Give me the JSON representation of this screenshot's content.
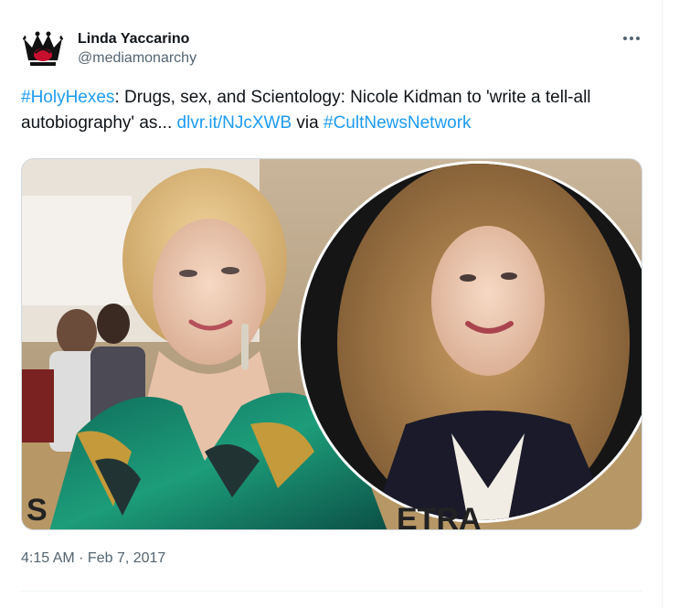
{
  "author": {
    "display_name": "Linda Yaccarino",
    "handle": "@mediamonarchy"
  },
  "tweet": {
    "hashtag1": "#HolyHexes",
    "text1": ": Drugs, sex, and Scientology: Nicole Kidman to 'write a tell-all autobiography' as... ",
    "link": "dlvr.it/NJcXWB",
    "text2": " via ",
    "hashtag2": "#CultNewsNetwork"
  },
  "media": {
    "sign_text": "ETRA",
    "sign_text_left": "S"
  },
  "meta": {
    "time": "4:15 AM",
    "separator": " · ",
    "date": "Feb 7, 2017"
  },
  "colors": {
    "link": "#1d9bf0",
    "secondary_text": "#536471",
    "primary_text": "#0f1419"
  },
  "icons": {
    "more": "more-horizontal-icon",
    "avatar": "crown-logo-icon"
  }
}
